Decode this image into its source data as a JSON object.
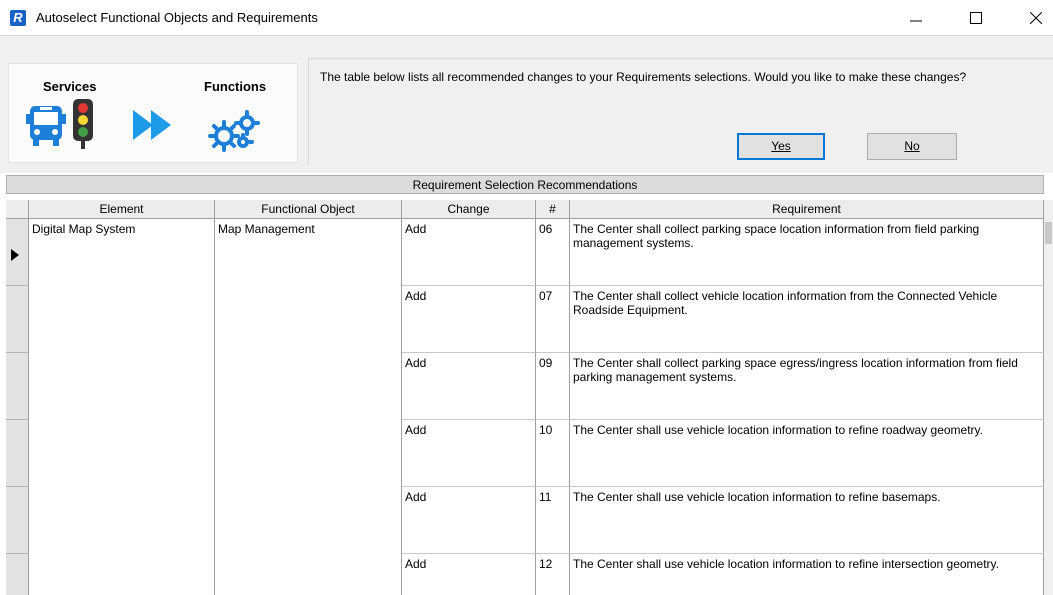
{
  "window": {
    "app_icon_letter": "R",
    "title": "Autoselect Functional Objects and Requirements"
  },
  "wizard": {
    "services_label": "Services",
    "functions_label": "Functions"
  },
  "prompt": {
    "message": "The table below lists all recommended changes to your Requirements selections.  Would you like to make these changes?",
    "yes_label": "Yes",
    "no_label": "No"
  },
  "grid": {
    "caption": "Requirement Selection Recommendations",
    "columns": [
      "Element",
      "Functional Object",
      "Change",
      "#",
      "Requirement"
    ],
    "element": "Digital Map System",
    "functional_object": "Map Management",
    "rows": [
      {
        "change": "Add",
        "num": "06",
        "requirement": "The Center shall collect parking space location information from field parking management systems."
      },
      {
        "change": "Add",
        "num": "07",
        "requirement": "The Center shall collect vehicle location information from the Connected Vehicle Roadside Equipment."
      },
      {
        "change": "Add",
        "num": "09",
        "requirement": "The Center shall collect parking space egress/ingress location information from field parking management systems."
      },
      {
        "change": "Add",
        "num": "10",
        "requirement": "The Center shall use vehicle location information to refine roadway geometry."
      },
      {
        "change": "Add",
        "num": "11",
        "requirement": "The Center shall use vehicle location information to refine basemaps."
      },
      {
        "change": "Add",
        "num": "12",
        "requirement": "The Center shall use vehicle location information to refine intersection geometry."
      }
    ]
  },
  "colors": {
    "accent": "#0078d7",
    "app_icon": "#1a63c6",
    "icon_blue": "#1e7fd8"
  },
  "icons": [
    "app-icon",
    "minimize-icon",
    "maximize-icon",
    "close-icon",
    "bus-icon",
    "traffic-light-icon",
    "double-arrow-icon",
    "gears-icon",
    "row-selector-arrow-icon"
  ]
}
